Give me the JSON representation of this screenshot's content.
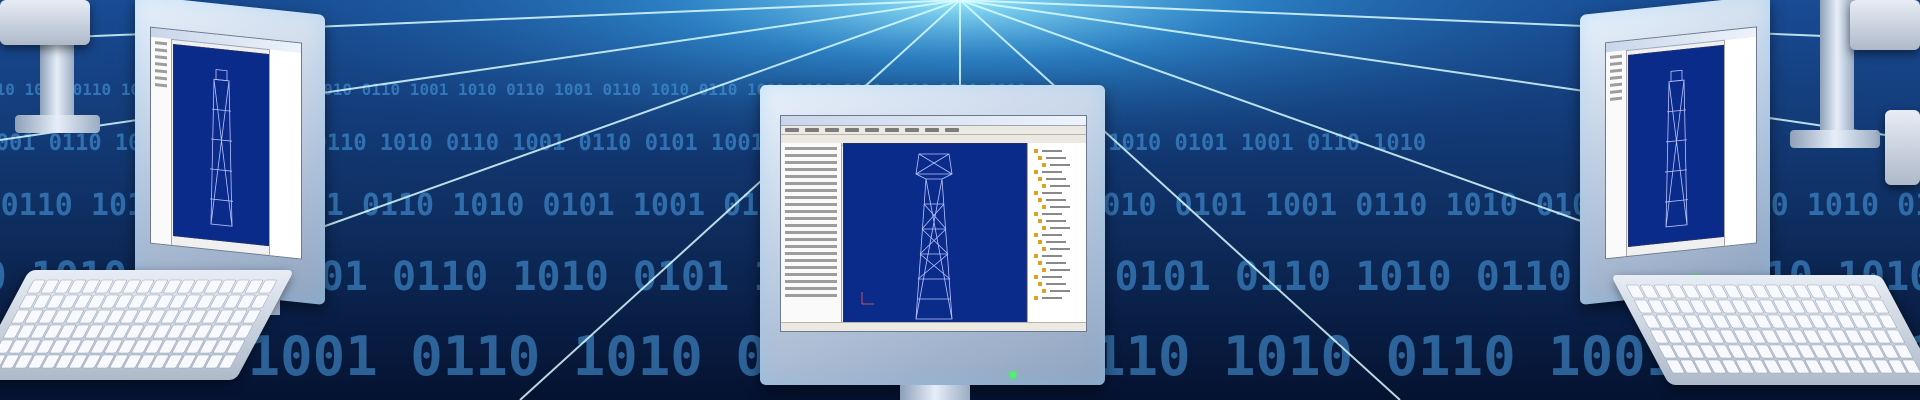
{
  "colors": {
    "background": "#06173a",
    "grid_glow": "#7fd8ff",
    "viewport_blue": "#0b2b8a",
    "tower_line": "#b8c4ff",
    "led_green": "#3dff5a"
  },
  "icons": [
    "desktop-monitor-icon",
    "keyboard-icon",
    "transmission-tower-icon",
    "binary-digits-icon"
  ],
  "binary_rows": [
    "0110 1010 0110 1001 0110 1010 0110 1001 0110 1010 0110 1001",
    "1010 0110 1001 0110 1010 0110 1001 0110 1010 0110 1001 0110",
    "0101 1001 0110 1010 0101 1001 0110 1010 0101 1001 0110 1010",
    "1001 0110 1010 0101 1001 0110 1010 0101 1001 0110 1010 0101"
  ]
}
